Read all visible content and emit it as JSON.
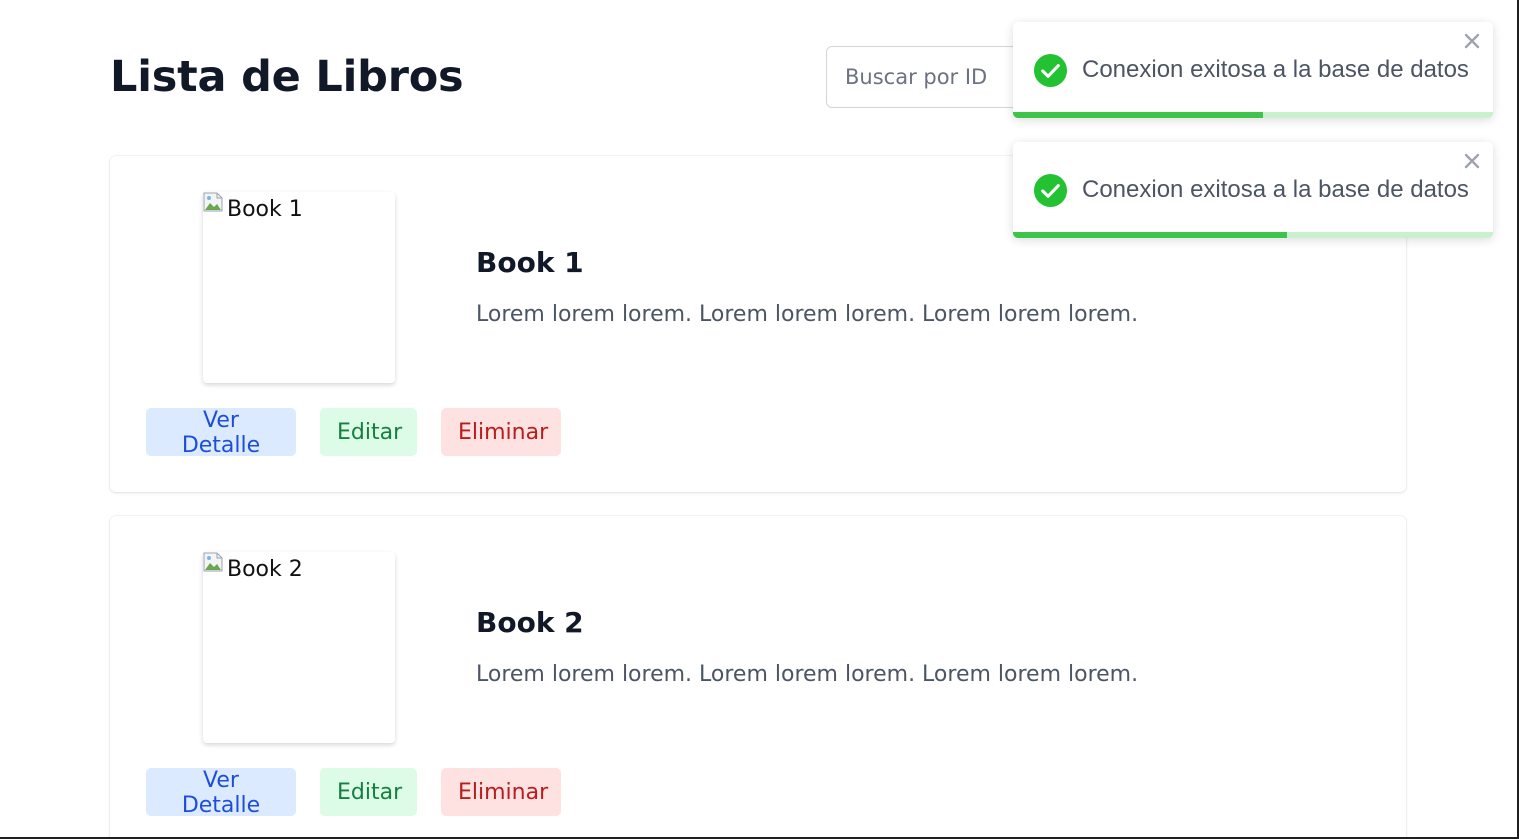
{
  "header": {
    "title": "Lista de Libros"
  },
  "search": {
    "placeholder": "Buscar por ID",
    "value": ""
  },
  "books": [
    {
      "image_alt": "Book 1",
      "title": "Book 1",
      "description": "Lorem lorem lorem. Lorem lorem lorem. Lorem lorem lorem.",
      "actions": {
        "view": "Ver Detalle",
        "edit": "Editar",
        "delete": "Eliminar"
      }
    },
    {
      "image_alt": "Book 2",
      "title": "Book 2",
      "description": "Lorem lorem lorem. Lorem lorem lorem. Lorem lorem lorem.",
      "actions": {
        "view": "Ver Detalle",
        "edit": "Editar",
        "delete": "Eliminar"
      }
    }
  ],
  "toasts": [
    {
      "message": "Conexion exitosa a la base de datos",
      "icon": "check-circle-icon",
      "progress": 0.52
    },
    {
      "message": "Conexion exitosa a la base de datos",
      "icon": "check-circle-icon",
      "progress": 0.57
    }
  ],
  "colors": {
    "success": "#3ec44a",
    "view_button_bg": "#dbeafe",
    "view_button_text": "#1d4ed8",
    "edit_button_bg": "#dcfce7",
    "edit_button_text": "#15803d",
    "delete_button_bg": "#fee2e2",
    "delete_button_text": "#b91c1c"
  }
}
